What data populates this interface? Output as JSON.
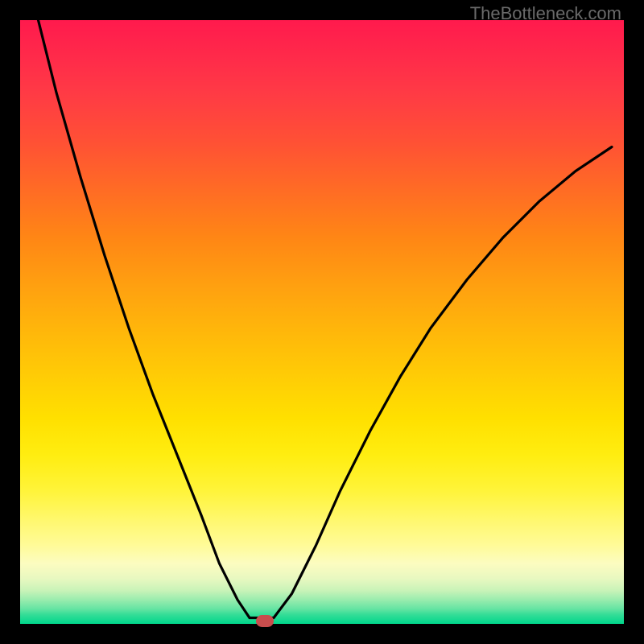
{
  "attribution": "TheBottleneck.com",
  "chart_data": {
    "type": "line",
    "title": "",
    "xlabel": "",
    "ylabel": "",
    "xlim": [
      0,
      100
    ],
    "ylim": [
      0,
      100
    ],
    "min_point_x": 40,
    "series": [
      {
        "name": "left-branch",
        "x": [
          3,
          6,
          10,
          14,
          18,
          22,
          26,
          30,
          33,
          36,
          38
        ],
        "values": [
          100,
          88,
          74,
          61,
          49,
          38,
          28,
          18,
          10,
          4,
          1
        ]
      },
      {
        "name": "flat-bottom",
        "x": [
          38,
          42
        ],
        "values": [
          1,
          1
        ]
      },
      {
        "name": "right-branch",
        "x": [
          42,
          45,
          49,
          53,
          58,
          63,
          68,
          74,
          80,
          86,
          92,
          98
        ],
        "values": [
          1,
          5,
          13,
          22,
          32,
          41,
          49,
          57,
          64,
          70,
          75,
          79
        ]
      }
    ],
    "marker": {
      "x": 40.5,
      "y": 0.5,
      "color": "#c94d4d"
    },
    "gradient_stops": [
      {
        "pos": 0,
        "color": "#ff1a4d"
      },
      {
        "pos": 50,
        "color": "#ffb000"
      },
      {
        "pos": 80,
        "color": "#fff870"
      },
      {
        "pos": 100,
        "color": "#00d68c"
      }
    ]
  }
}
